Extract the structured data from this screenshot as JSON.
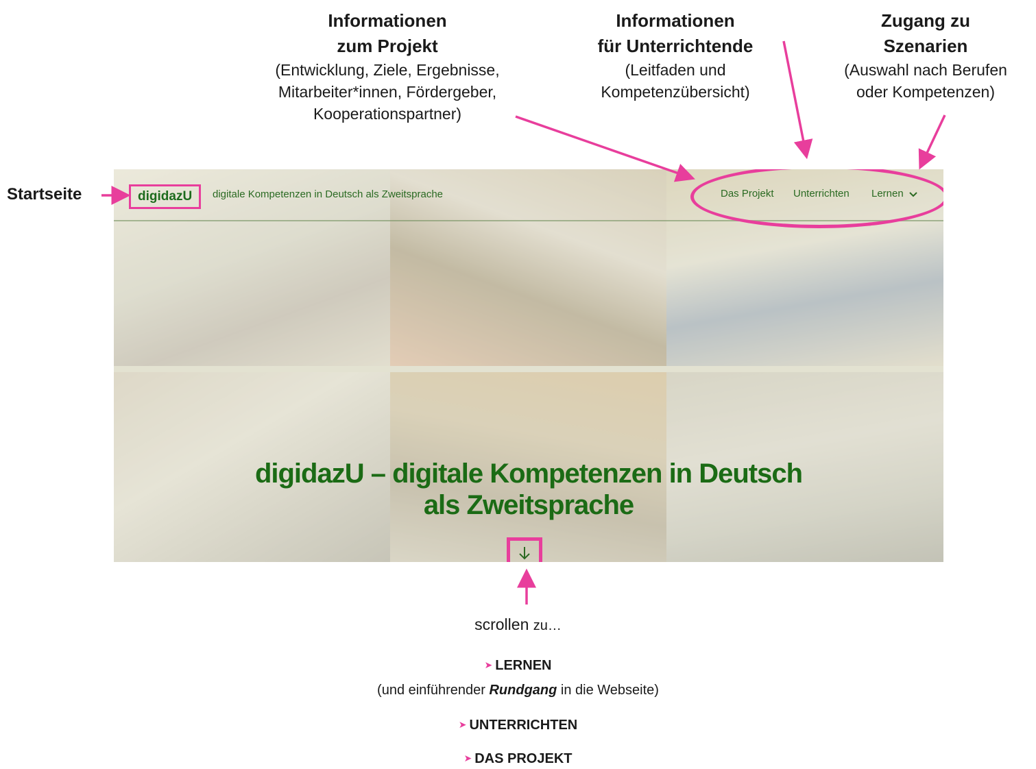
{
  "annotations": {
    "project": {
      "title_line1": "Informationen",
      "title_line2": "zum Projekt",
      "desc_line1": "(Entwicklung, Ziele, Ergebnisse,",
      "desc_line2": "Mitarbeiter*innen, Fördergeber,",
      "desc_line3": "Kooperationspartner)"
    },
    "teaching": {
      "title_line1": "Informationen",
      "title_line2": "für Unterrichtende",
      "desc_line1": "(Leitfaden und",
      "desc_line2": "Kompetenzübersicht)"
    },
    "scenarios": {
      "title_line1": "Zugang zu",
      "title_line2": "Szenarien",
      "desc_line1": "(Auswahl nach Berufen",
      "desc_line2": "oder Kompetenzen)"
    },
    "start": "Startseite"
  },
  "site": {
    "logo": "digidazU",
    "tagline": "digitale Kompetenzen in Deutsch als Zweitsprache",
    "nav": [
      "Das Projekt",
      "Unterrichten",
      "Lernen"
    ],
    "hero_line1": "digidazU – digitale Kompetenzen in Deutsch",
    "hero_line2": "als Zweitsprache"
  },
  "scroll": {
    "text": "scrollen",
    "suffix": "zu…",
    "items": [
      {
        "label": "LERNEN",
        "sub_before": "(und einführender ",
        "sub_bold": "Rundgang",
        "sub_after": " in die Webseite)"
      },
      {
        "label": "UNTERRICHTEN"
      },
      {
        "label": "DAS PROJEKT"
      }
    ]
  },
  "colors": {
    "highlight": "#e83e9c",
    "brand_green": "#1b6b15"
  },
  "icons": [
    "chevron-down-icon",
    "arrow-down-icon",
    "triangle-bullet-icon"
  ]
}
